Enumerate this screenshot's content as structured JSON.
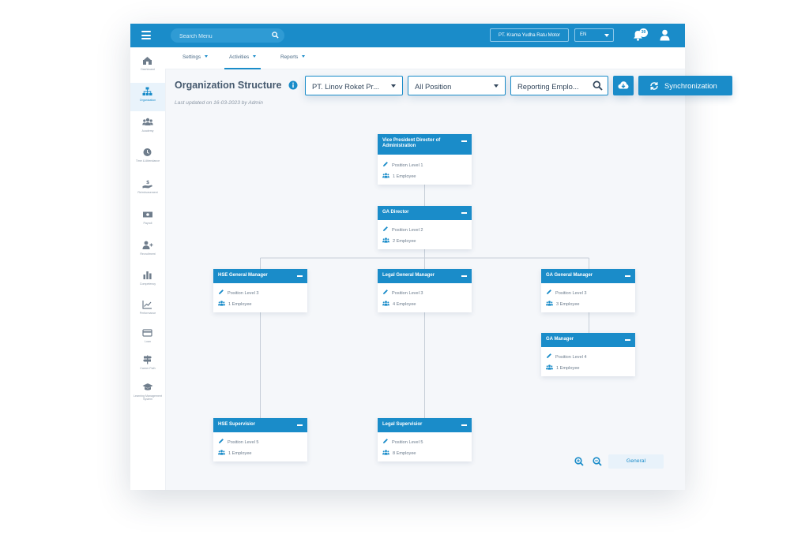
{
  "topbar": {
    "search_placeholder": "Search Menu",
    "company": "PT. Krama Yudha Ratu Motor",
    "language": "EN",
    "notification_count": "39"
  },
  "sidebar": {
    "items": [
      {
        "label": "Dashboard",
        "icon": "dashboard-icon"
      },
      {
        "label": "Organization",
        "icon": "org-chart-icon",
        "active": true
      },
      {
        "label": "Academy",
        "icon": "people-icon"
      },
      {
        "label": "Time & Attendance",
        "icon": "clock-icon"
      },
      {
        "label": "Reimbursement",
        "icon": "money-hand-icon"
      },
      {
        "label": "Payroll",
        "icon": "cash-icon"
      },
      {
        "label": "Recruitment",
        "icon": "user-plus-icon"
      },
      {
        "label": "Competency",
        "icon": "bar-chart-icon"
      },
      {
        "label": "Performance",
        "icon": "line-chart-icon"
      },
      {
        "label": "Loan",
        "icon": "card-icon"
      },
      {
        "label": "Career Path",
        "icon": "signpost-icon"
      },
      {
        "label": "Learning Management System",
        "icon": "graduation-cap-icon"
      }
    ]
  },
  "subnav": {
    "tabs": [
      {
        "label": "Settings"
      },
      {
        "label": "Activities",
        "active": true
      },
      {
        "label": "Reports"
      }
    ]
  },
  "header": {
    "title": "Organization Structure",
    "updated": "Last updated on 16-03-2023 by Admin"
  },
  "filters": {
    "company": "PT. Linov Roket Pr...",
    "position": "All Position",
    "reporting": "Reporting Emplo..."
  },
  "actions": {
    "sync_label": "Synchronization"
  },
  "org": {
    "nodes": [
      {
        "title": "Vice President Director of Administration",
        "level": "Position Level 1",
        "employees": "1 Employee"
      },
      {
        "title": "GA Director",
        "level": "Position Level 2",
        "employees": "2 Employee"
      },
      {
        "title": "HSE General Manager",
        "level": "Position Level 3",
        "employees": "1 Employee"
      },
      {
        "title": "Legal General Manager",
        "level": "Position Level 3",
        "employees": "4 Employee"
      },
      {
        "title": "GA General Manager",
        "level": "Position Level 3",
        "employees": "3 Employee"
      },
      {
        "title": "GA Manager",
        "level": "Position Level 4",
        "employees": "1 Employee"
      },
      {
        "title": "HSE Supervisior",
        "level": "Position Level 5",
        "employees": "1 Employee"
      },
      {
        "title": "Legal Supervisior",
        "level": "Position Level 5",
        "employees": "8 Employee"
      }
    ]
  },
  "footer": {
    "general_label": "General"
  },
  "colors": {
    "primary": "#1a8cc9",
    "background": "#f5f7fa"
  }
}
